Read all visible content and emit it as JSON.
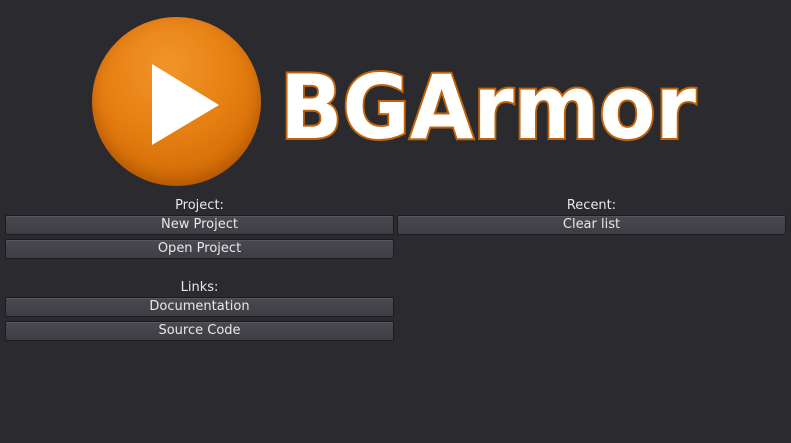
{
  "logo": {
    "wordmark": "BGArmor",
    "icon": "play-icon",
    "colors": {
      "orange": "#e67f12",
      "wordmark_fill": "#ffffff",
      "wordmark_outline": "#c2650a"
    }
  },
  "project": {
    "heading": "Project:",
    "new_project_label": "New Project",
    "open_project_label": "Open Project"
  },
  "links": {
    "heading": "Links:",
    "documentation_label": "Documentation",
    "source_code_label": "Source Code"
  },
  "recent": {
    "heading": "Recent:",
    "clear_list_label": "Clear list"
  },
  "colors": {
    "background": "#2b2a2f",
    "button": "#434248"
  }
}
